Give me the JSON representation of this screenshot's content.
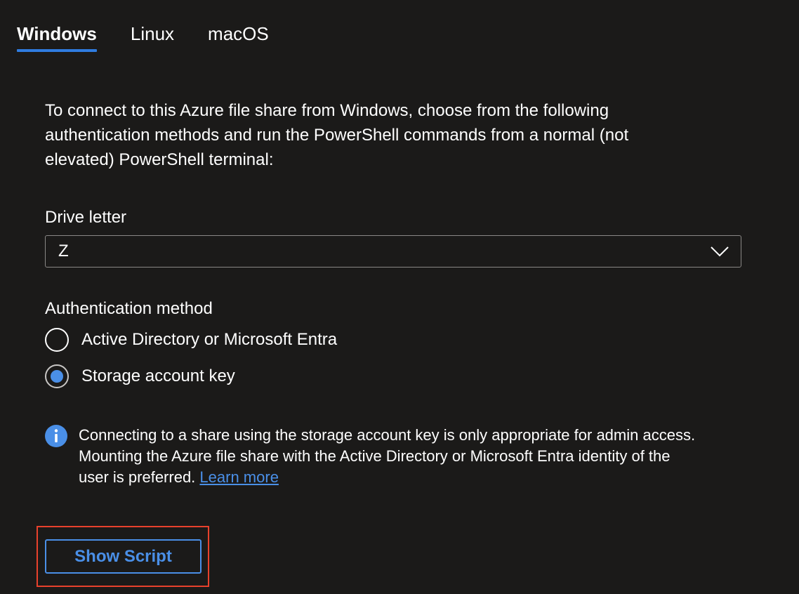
{
  "tabs": [
    {
      "label": "Windows",
      "active": true
    },
    {
      "label": "Linux",
      "active": false
    },
    {
      "label": "macOS",
      "active": false
    }
  ],
  "intro": "To connect to this Azure file share from Windows, choose from the following authentication methods and run the PowerShell commands from a normal (not elevated) PowerShell terminal:",
  "drive": {
    "label": "Drive letter",
    "value": "Z",
    "icon": "chevron-down-icon"
  },
  "auth": {
    "label": "Authentication method",
    "options": [
      {
        "label": "Active Directory or Microsoft Entra",
        "selected": false
      },
      {
        "label": "Storage account key",
        "selected": true
      }
    ]
  },
  "info": {
    "icon": "info-icon",
    "text": "Connecting to a share using the storage account key is only appropriate for admin access. Mounting the Azure file share with the Active Directory or Microsoft Entra identity of the user is preferred.",
    "link": "Learn more"
  },
  "button": {
    "label": "Show Script"
  },
  "colors": {
    "background": "#1b1a19",
    "accent": "#2f7ce0",
    "link": "#4a8fe7",
    "highlight": "#e8412c"
  }
}
